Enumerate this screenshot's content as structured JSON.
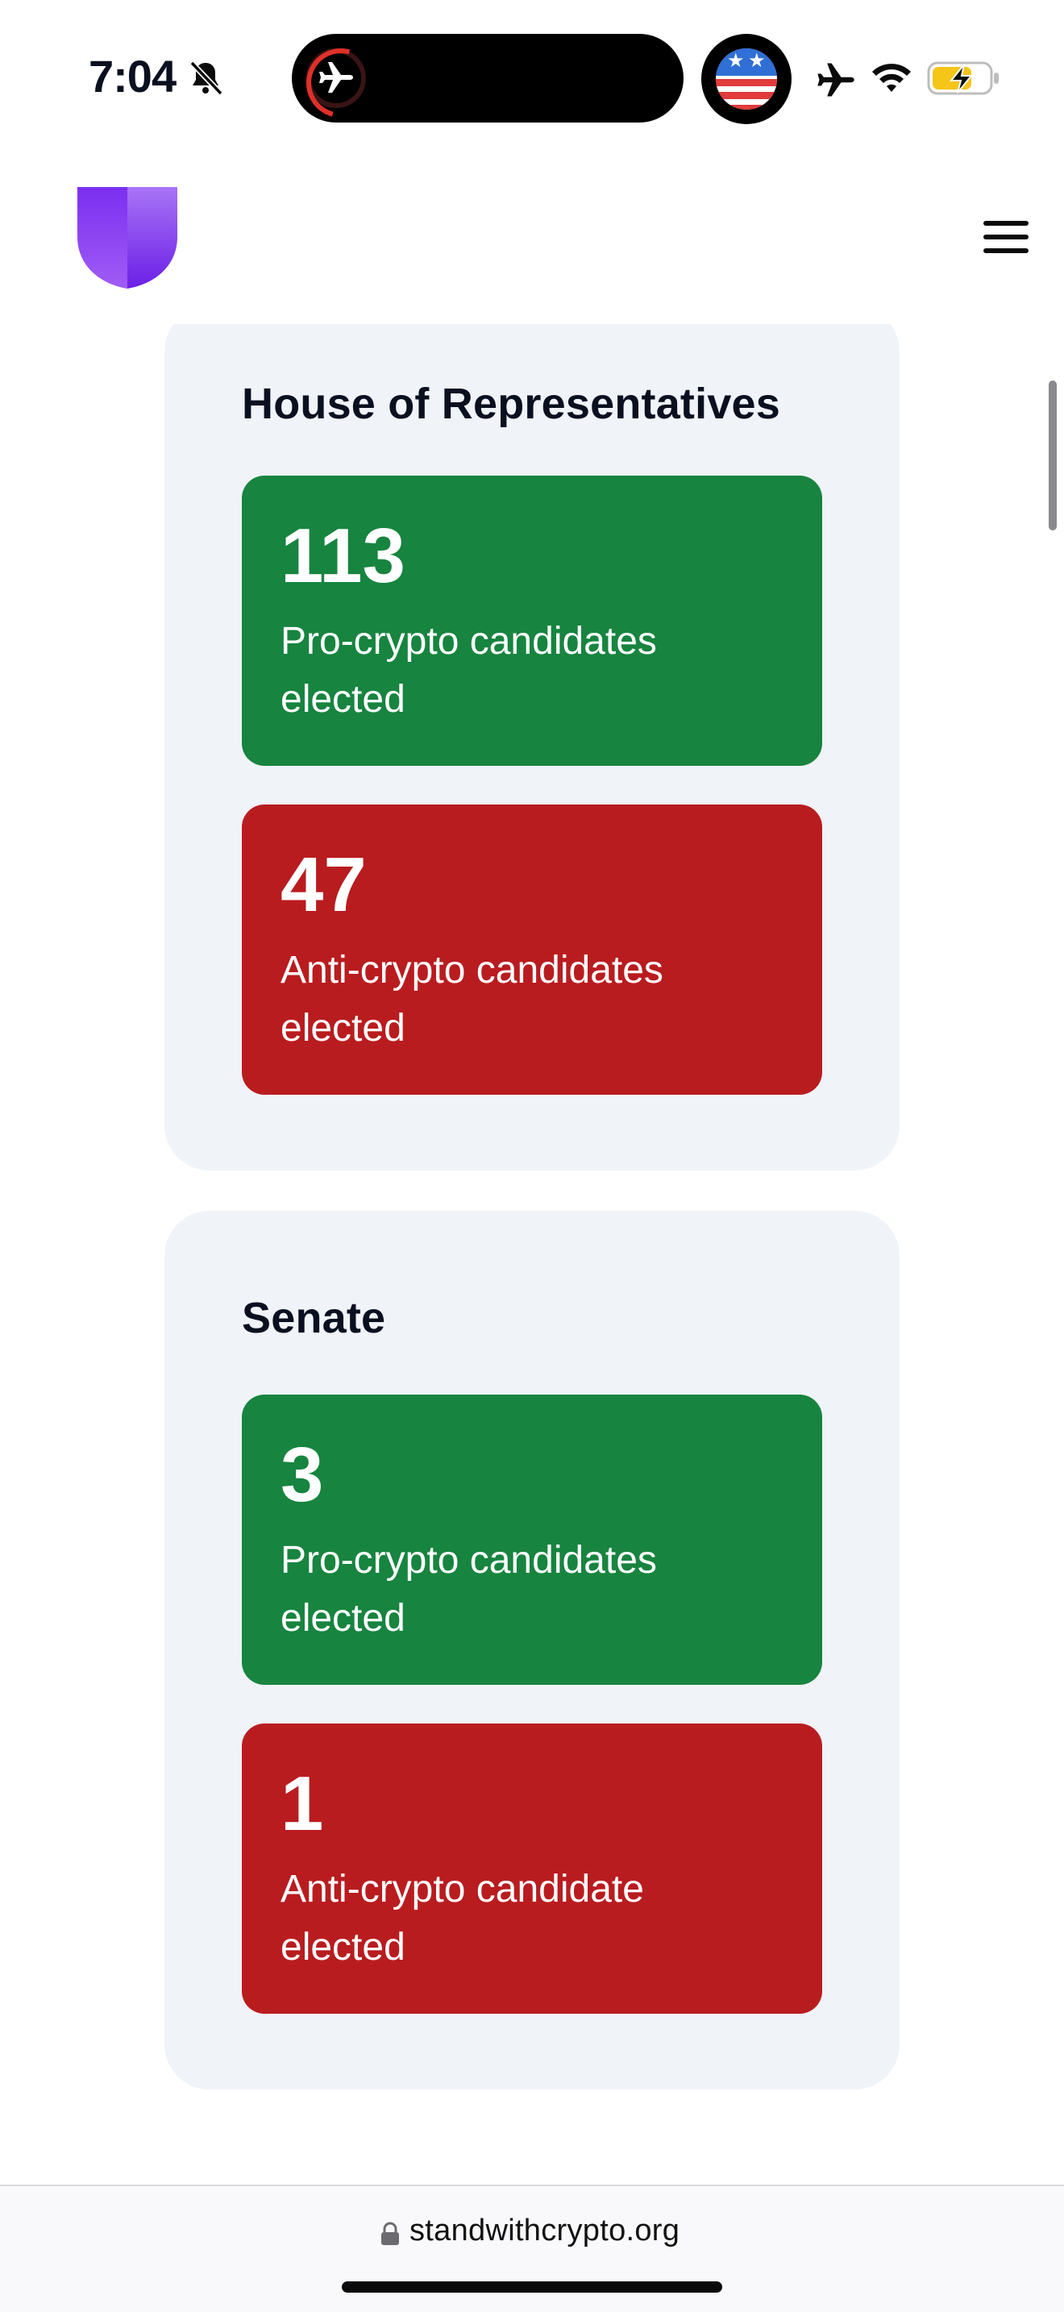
{
  "status_bar": {
    "time": "7:04",
    "icons": [
      "bell-slash-icon",
      "airplane-icon",
      "flag-badge-icon",
      "airplane-icon",
      "wifi-icon",
      "battery-charging-icon"
    ],
    "battery_color": "#f5c518"
  },
  "header": {
    "logo": "shield-logo",
    "menu_icon": "hamburger-menu-icon"
  },
  "house": {
    "title": "House of Representatives",
    "pro": {
      "count": "113",
      "label": "Pro-crypto candidates elected"
    },
    "anti": {
      "count": "47",
      "label": "Anti-crypto candidates elected"
    }
  },
  "senate": {
    "title": "Senate",
    "pro": {
      "count": "3",
      "label": "Pro-crypto candidates elected"
    },
    "anti": {
      "count": "1",
      "label": "Anti-crypto candidate elected"
    }
  },
  "browser": {
    "url": "standwithcrypto.org",
    "lock_icon": "lock-icon"
  },
  "colors": {
    "pro": "#17843f",
    "anti": "#b91c1f",
    "card_bg": "#f0f3f8",
    "brand_purple": "#7a3cf0"
  }
}
